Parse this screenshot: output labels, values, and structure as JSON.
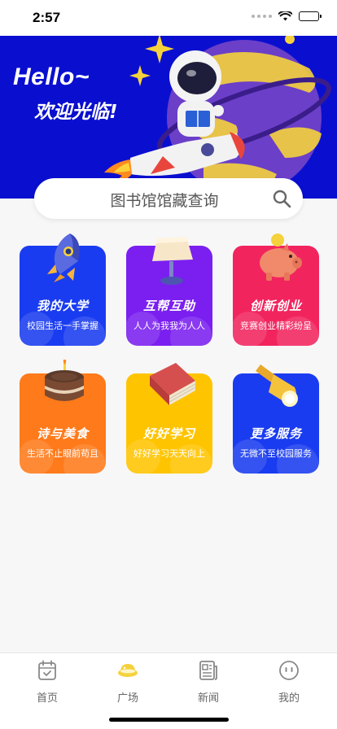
{
  "status_bar": {
    "time": "2:57"
  },
  "banner": {
    "greeting": "Hello~",
    "welcome": "欢迎光临!"
  },
  "search": {
    "label": "图书馆馆藏查询",
    "icon": "search-icon"
  },
  "cards": [
    {
      "title": "我的大学",
      "subtitle": "校园生活一手掌握",
      "color": "#1a3cf0",
      "icon": "rocket-icon"
    },
    {
      "title": "互帮互助",
      "subtitle": "人人为我我为人人",
      "color": "#7a1ff0",
      "icon": "lamp-icon"
    },
    {
      "title": "创新创业",
      "subtitle": "竞赛创业精彩纷呈",
      "color": "#f2245e",
      "icon": "piggy-bank-icon"
    },
    {
      "title": "诗与美食",
      "subtitle": "生活不止眼前苟且",
      "color": "#ff7a1a",
      "icon": "cake-icon"
    },
    {
      "title": "好好学习",
      "subtitle": "好好学习天天向上",
      "color": "#ffc400",
      "icon": "book-icon"
    },
    {
      "title": "更多服务",
      "subtitle": "无微不至校园服务",
      "color": "#1a3cf0",
      "icon": "flashlight-icon"
    }
  ],
  "tabs": [
    {
      "label": "首页",
      "icon": "calendar-icon",
      "active": false
    },
    {
      "label": "广场",
      "icon": "planet-icon",
      "active": true
    },
    {
      "label": "新闻",
      "icon": "newspaper-icon",
      "active": false
    },
    {
      "label": "我的",
      "icon": "face-icon",
      "active": false
    }
  ],
  "colors": {
    "banner_bg": "#0a0fcf",
    "accent_yellow": "#f5d23c"
  }
}
